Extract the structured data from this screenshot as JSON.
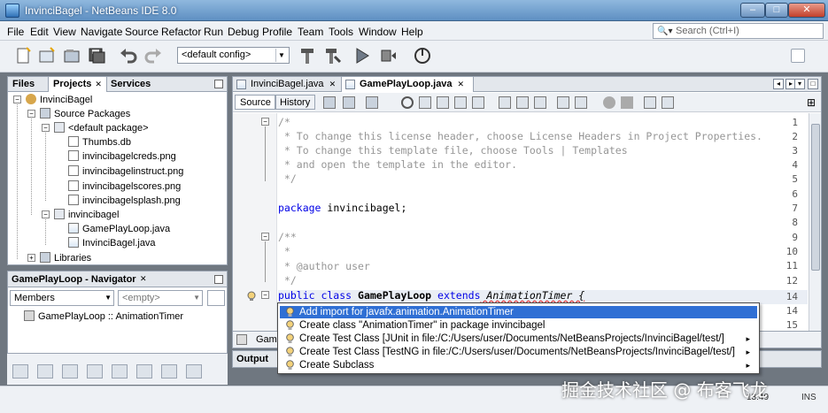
{
  "window": {
    "title": "InvinciBagel - NetBeans IDE 8.0",
    "min": "–",
    "max": "□",
    "close": "✕"
  },
  "menu": [
    "File",
    "Edit",
    "View",
    "Navigate",
    "Source",
    "Refactor",
    "Run",
    "Debug",
    "Profile",
    "Team",
    "Tools",
    "Window",
    "Help"
  ],
  "search": {
    "placeholder": "Search (Ctrl+I)"
  },
  "toolbar": {
    "config": "<default config>"
  },
  "projects": {
    "tabs": [
      "Files",
      "Projects",
      "Services"
    ],
    "tree": [
      "InvinciBagel",
      "Source Packages",
      "<default package>",
      "Thumbs.db",
      "invincibagelcreds.png",
      "invincibagelinstruct.png",
      "invincibagelscores.png",
      "invincibagelsplash.png",
      "invincibagel",
      "GamePlayLoop.java",
      "InvinciBagel.java",
      "Libraries"
    ]
  },
  "navigator": {
    "title": "GamePlayLoop - Navigator",
    "members": "Members",
    "filter": "<empty>",
    "item": "GamePlayLoop :: AnimationTimer"
  },
  "editor": {
    "tabs": [
      "InvinciBagel.java",
      "GamePlayLoop.java"
    ],
    "modes": [
      "Source",
      "History"
    ],
    "lines": [
      "1",
      "2",
      "3",
      "4",
      "5",
      "6",
      "7",
      "8",
      "9",
      "10",
      "11",
      "12",
      "13",
      "14",
      "15"
    ],
    "code": {
      "l1": "/*",
      "l2": " * To change this license header, choose License Headers in Project Properties.",
      "l3": " * To change this template file, choose Tools | Templates",
      "l4": " * and open the template in the editor.",
      "l5": " */",
      "l7a": "package",
      "l7b": " invincibagel;",
      "l9": "/**",
      "l10": " *",
      "l11": " * @author user",
      "l12": " */",
      "l13a": "public class",
      "l13b": " GamePlayLoop ",
      "l13c": "extends",
      "l13d": " AnimationTimer {"
    },
    "nav_strip": "Game"
  },
  "output": {
    "label": "Output"
  },
  "popup": [
    {
      "text": "Add import for javafx.animation.AnimationTimer",
      "sub": ""
    },
    {
      "text": "Create class \"AnimationTimer\" in package invincibagel",
      "sub": ""
    },
    {
      "text": "Create Test Class [JUnit in file:/C:/Users/user/Documents/NetBeansProjects/InvinciBagel/test/]",
      "sub": "▸"
    },
    {
      "text": "Create Test Class [TestNG in file:/C:/Users/user/Documents/NetBeansProjects/InvinciBagel/test/]",
      "sub": "▸"
    },
    {
      "text": "Create Subclass",
      "sub": "▸"
    }
  ],
  "status": {
    "time": "13:49",
    "ins": "INS"
  },
  "watermark": "掘金技术社区 @ 布客飞龙",
  "colors": {
    "selection": "#2f6fd4",
    "keyword": "#0000e6",
    "comment": "#969696"
  }
}
